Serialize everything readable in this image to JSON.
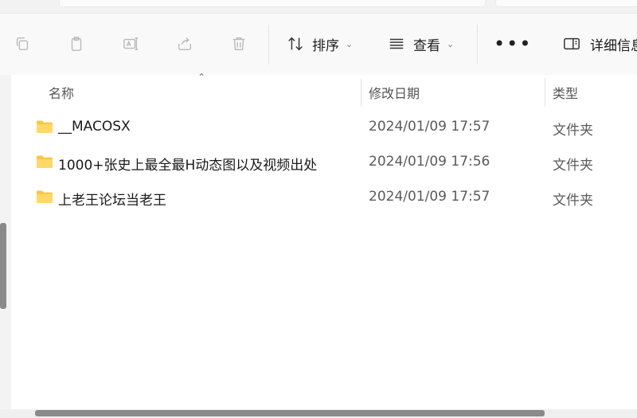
{
  "toolbar": {
    "sort_label": "排序",
    "view_label": "查看",
    "more_label": "•••",
    "details_label": "详细信息"
  },
  "columns": {
    "name": "名称",
    "date": "修改日期",
    "type": "类型"
  },
  "files": [
    {
      "name": "__MACOSX",
      "date": "2024/01/09 17:57",
      "type": "文件夹"
    },
    {
      "name": "1000+张史上最全最H动态图以及视频出处",
      "date": "2024/01/09 17:56",
      "type": "文件夹"
    },
    {
      "name": "上老王论坛当老王",
      "date": "2024/01/09 17:57",
      "type": "文件夹"
    }
  ],
  "icons": {
    "copy": "copy-icon",
    "paste": "paste-icon",
    "rename": "rename-icon",
    "share": "share-icon",
    "delete": "delete-icon",
    "sort": "sort-arrows-icon",
    "view": "view-lines-icon",
    "details": "details-pane-icon",
    "folder": "folder-icon"
  },
  "colors": {
    "folder": "#f6c744",
    "toolbar_bg": "#f9f9f9"
  }
}
